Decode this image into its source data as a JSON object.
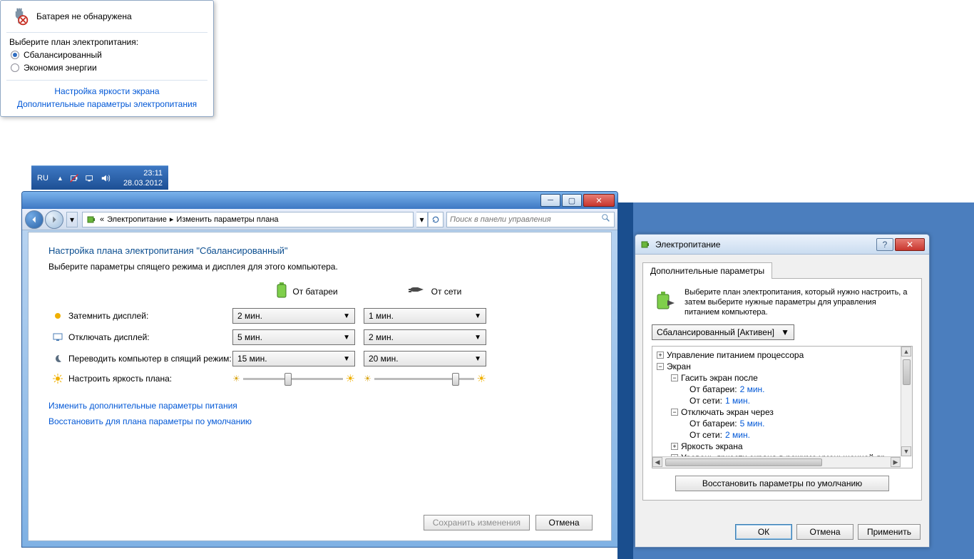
{
  "batteryPopup": {
    "status": "Батарея не обнаружена",
    "selectLabel": "Выберите план электропитания:",
    "plan1": "Сбалансированный",
    "plan2": "Экономия энергии",
    "link1": "Настройка яркости экрана",
    "link2": "Дополнительные параметры электропитания"
  },
  "taskbar": {
    "lang": "RU",
    "time": "23:11",
    "date": "28.03.2012"
  },
  "cpWindow": {
    "breadcrumb1": "Электропитание",
    "breadcrumb2": "Изменить параметры плана",
    "breadcrumbGlyph": "«",
    "searchPlaceholder": "Поиск в панели управления",
    "title": "Настройка плана электропитания \"Сбалансированный\"",
    "subtitle": "Выберите параметры спящего режима и дисплея для этого компьютера.",
    "colBattery": "От батареи",
    "colAC": "От сети",
    "rowDim": "Затемнить дисплей:",
    "rowOff": "Отключать дисплей:",
    "rowSleep": "Переводить компьютер в спящий режим:",
    "rowBrightness": "Настроить яркость плана:",
    "dimBattery": "2 мин.",
    "dimAC": "1 мин.",
    "offBattery": "5 мин.",
    "offAC": "2 мин.",
    "sleepBattery": "15 мин.",
    "sleepAC": "20 мин.",
    "linkAdvanced": "Изменить дополнительные параметры питания",
    "linkRestore": "Восстановить для плана параметры по умолчанию",
    "btnSave": "Сохранить изменения",
    "btnCancel": "Отмена"
  },
  "advDialog": {
    "title": "Электропитание",
    "tab": "Дополнительные параметры",
    "desc": "Выберите план электропитания, который нужно настроить, а затем выберите нужные параметры для управления питанием компьютера.",
    "planSelected": "Сбалансированный [Активен]",
    "tree": {
      "n1": "Управление питанием процессора",
      "n2": "Экран",
      "n2a": "Гасить экран после",
      "n2a1l": "От батареи:",
      "n2a1v": "2 мин.",
      "n2a2l": "От сети:",
      "n2a2v": "1 мин.",
      "n2b": "Отключать экран через",
      "n2b1l": "От батареи:",
      "n2b1v": "5 мин.",
      "n2b2l": "От сети:",
      "n2b2v": "2 мин.",
      "n2c": "Яркость экрана",
      "n2d": "Уровень яркости экрана в режиме уменьшенной яр"
    },
    "btnRestore": "Восстановить параметры по умолчанию",
    "btnOK": "ОК",
    "btnCancel": "Отмена",
    "btnApply": "Применить"
  }
}
